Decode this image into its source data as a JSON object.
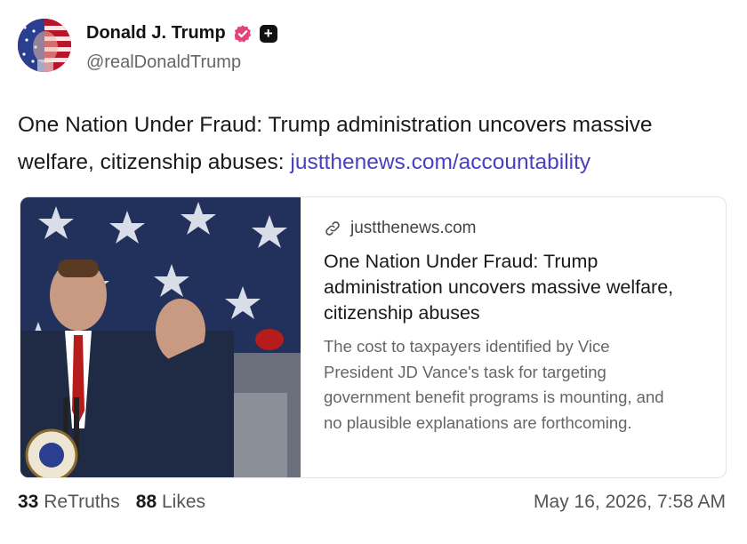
{
  "author": {
    "name": "Donald J. Trump",
    "handle": "@realDonaldTrump",
    "verified_color": "#e0457b"
  },
  "post": {
    "text": "One Nation Under Fraud: Trump administration uncovers massive welfare, citizenship abuses: ",
    "link": "justthenews.com/accountability",
    "link_color": "#4a3fc1"
  },
  "link_card": {
    "domain": "justthenews.com",
    "title": "One Nation Under Fraud: Trump administration uncovers massive welfare, citizenship abuses",
    "description": "The cost to taxpayers identified by Vice President JD Vance's task for targeting government benefit programs is mounting, and no plausible explanations are forthcoming."
  },
  "footer": {
    "retruths_count": "33",
    "retruths_label": "ReTruths",
    "likes_count": "88",
    "likes_label": "Likes",
    "timestamp": "May 16, 2026, 7:58 AM"
  }
}
